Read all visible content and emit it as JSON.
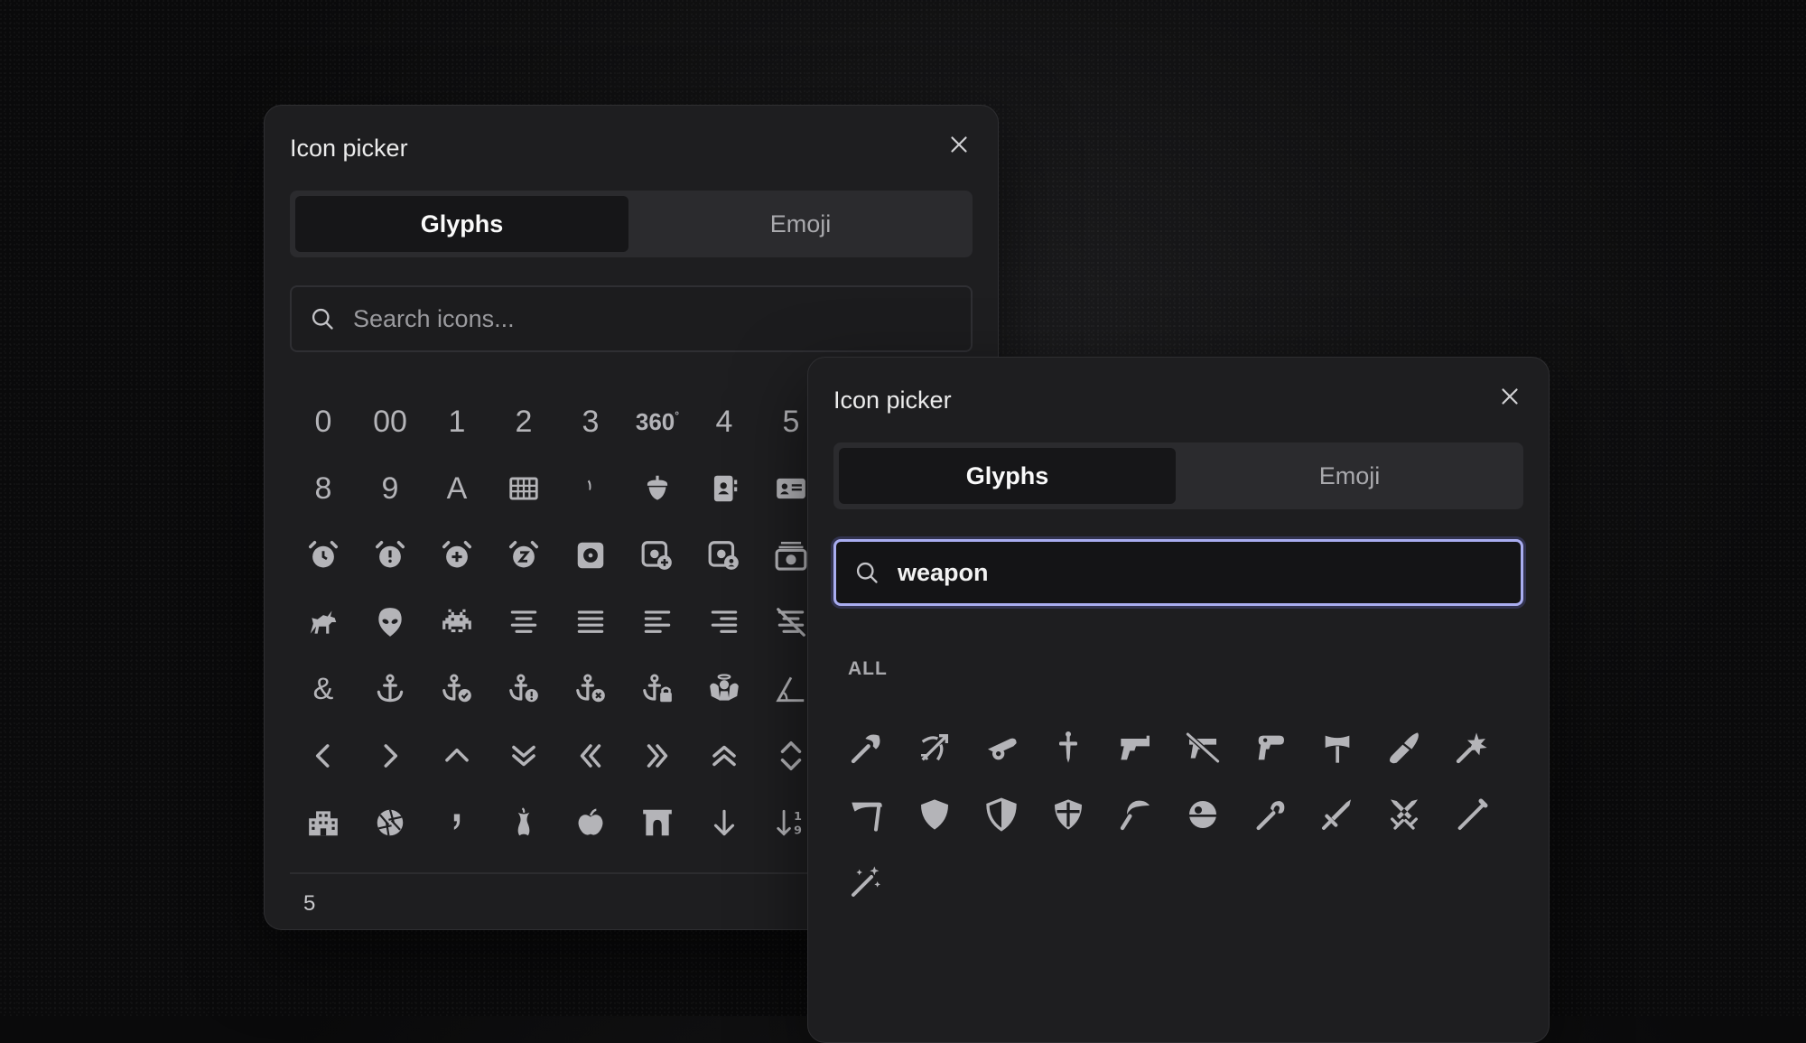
{
  "back_panel": {
    "title": "Icon picker",
    "tabs": [
      {
        "label": "Glyphs",
        "active": true
      },
      {
        "label": "Emoji",
        "active": false
      }
    ],
    "search": {
      "placeholder": "Search icons...",
      "value": ""
    },
    "rows": [
      [
        "0",
        "00",
        "1",
        "2",
        "3",
        "360",
        "4",
        "5"
      ],
      [
        "8",
        "9",
        "A",
        "abacus-icon",
        "acorn-cap-icon",
        "acorn-icon",
        "address-book-icon",
        "address-card-icon"
      ],
      [
        "alarm-clock-icon",
        "alarm-exclamation-icon",
        "alarm-plus-icon",
        "alarm-snooze-icon",
        "album-icon",
        "album-circle-plus-icon",
        "album-circle-user-icon",
        "album-collection-icon"
      ],
      [
        "alicorn-icon",
        "alien-icon",
        "alien-8bit-icon",
        "align-center-icon",
        "align-justify-icon",
        "align-left-icon",
        "align-right-icon",
        "align-slash-icon"
      ],
      [
        "&",
        "anchor-icon",
        "anchor-circle-check-icon",
        "anchor-circle-exclamation-icon",
        "anchor-circle-xmark-icon",
        "anchor-lock-icon",
        "angel-icon",
        "angle-90-icon"
      ],
      [
        "angle-left-icon",
        "angle-right-icon",
        "angle-up-icon",
        "angles-down-icon",
        "angles-left-icon",
        "angles-right-icon",
        "angles-up-icon",
        "angles-up-down-icon"
      ],
      [
        "apartment-icon",
        "aperture-icon",
        "apostrophe-icon",
        "apple-core-icon",
        "apple-whole-icon",
        "archway-icon",
        "arrow-down-icon",
        "arrow-down-1-9-icon"
      ]
    ],
    "footer_count": "5"
  },
  "front_panel": {
    "title": "Icon picker",
    "tabs": [
      {
        "label": "Glyphs",
        "active": true
      },
      {
        "label": "Emoji",
        "active": false
      }
    ],
    "search": {
      "placeholder": "Search icons...",
      "value": "weapon"
    },
    "section_label": "ALL",
    "icons": [
      "axe-icon",
      "bow-arrow-icon",
      "cannon-icon",
      "dagger-icon",
      "gun-icon",
      "gun-slash-icon",
      "gun-squirt-icon",
      "hammer-war-icon",
      "knife-kitchen-icon",
      "mace-icon",
      "scythe-icon",
      "shield-icon",
      "shield-halved-icon",
      "shield-cross-icon",
      "sickle-icon",
      "death-star-icon",
      "staff-icon",
      "sword-icon",
      "swords-icon",
      "wand-icon",
      "wand-sparkles-icon"
    ]
  },
  "colors": {
    "background": "#111112",
    "panel": "#1e1e20",
    "tab_active": "#161618",
    "tab_bar": "#2b2b2e",
    "icon": "#b4b4b8",
    "focus_ring": "#a9adf0"
  }
}
